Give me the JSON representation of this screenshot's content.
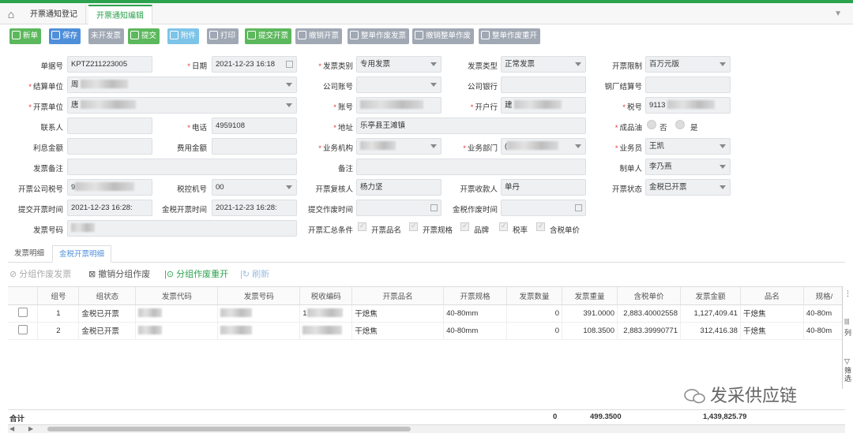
{
  "tabs": [
    "开票通知登记",
    "开票通知编辑"
  ],
  "toolbar": {
    "new": "新单",
    "save": "保存",
    "uninvoiced": "未开发票",
    "submit": "提交",
    "attach": "附件",
    "print": "打印",
    "submit_invoice": "提交开票",
    "cancel_invoice": "撤销开票",
    "void_whole": "整单作废发票",
    "cancel_void_whole": "撤销整单作废",
    "void_reissue": "整单作废重开"
  },
  "form": {
    "doc_no": {
      "label": "单据号",
      "value": "KPTZ211223005"
    },
    "date": {
      "label": "日期",
      "value": "2021-12-23 16:18"
    },
    "invoice_category": {
      "label": "发票类别",
      "value": "专用发票"
    },
    "invoice_type": {
      "label": "发票类型",
      "value": "正常发票"
    },
    "invoice_limit": {
      "label": "开票限制",
      "value": "百万元版"
    },
    "settle_unit": {
      "label": "结算单位",
      "value": "周"
    },
    "company_account": {
      "label": "公司账号",
      "value": ""
    },
    "company_bank": {
      "label": "公司银行",
      "value": ""
    },
    "mill_settle_no": {
      "label": "钢厂结算号",
      "value": ""
    },
    "invoice_unit": {
      "label": "开票单位",
      "value": "唐"
    },
    "account_no": {
      "label": "账号",
      "value": ""
    },
    "bank": {
      "label": "开户行",
      "value": "建"
    },
    "tax_no": {
      "label": "税号",
      "value": "9113"
    },
    "contact": {
      "label": "联系人",
      "value": ""
    },
    "phone": {
      "label": "电话",
      "value": "4959108"
    },
    "address": {
      "label": "地址",
      "value": "乐亭县王滩镇"
    },
    "oil": {
      "label": "成品油",
      "no": "否",
      "yes": "是"
    },
    "interest": {
      "label": "利息金额",
      "value": ""
    },
    "fee": {
      "label": "费用金额",
      "value": ""
    },
    "org": {
      "label": "业务机构",
      "value": ""
    },
    "dept": {
      "label": "业务部门",
      "value": "("
    },
    "salesman": {
      "label": "业务员",
      "value": "王凯"
    },
    "invoice_note": {
      "label": "发票备注",
      "value": ""
    },
    "note": {
      "label": "备注",
      "value": ""
    },
    "maker": {
      "label": "制单人",
      "value": "李乃燕"
    },
    "company_tax_no": {
      "label": "开票公司税号",
      "value": "9"
    },
    "tax_machine": {
      "label": "税控机号",
      "value": "00"
    },
    "reviewer": {
      "label": "开票复核人",
      "value": "杨力坚"
    },
    "payee": {
      "label": "开票收款人",
      "value": "单丹"
    },
    "status": {
      "label": "开票状态",
      "value": "金税已开票"
    },
    "submit_time": {
      "label": "提交开票时间",
      "value": "2021-12-23 16:28:"
    },
    "gold_time": {
      "label": "金税开票时间",
      "value": "2021-12-23 16:28:"
    },
    "void_submit_time": {
      "label": "提交作废时间",
      "value": ""
    },
    "gold_void_time": {
      "label": "金税作废时间",
      "value": ""
    },
    "invoice_no": {
      "label": "发票号码",
      "value": ""
    },
    "summary": {
      "label": "开票汇总条件",
      "opts": [
        "开票品名",
        "开票规格",
        "品牌",
        "税率",
        "含税单价"
      ]
    }
  },
  "subtabs": [
    "发票明细",
    "金税开票明细"
  ],
  "actions": {
    "group_void": "分组作废发票",
    "cancel_group_void": "撤销分组作废",
    "group_reissue": "分组作废重开",
    "refresh": "刷新"
  },
  "columns": [
    "组号",
    "组状态",
    "发票代码",
    "发票号码",
    "税收编码",
    "开票品名",
    "开票规格",
    "发票数量",
    "发票重量",
    "含税单价",
    "发票金额",
    "品名",
    "规格/"
  ],
  "rows": [
    {
      "group": "1",
      "status": "金税已开票",
      "code": "",
      "number": "",
      "tax_code": "1",
      "name": "干熄焦",
      "spec": "40-80mm",
      "qty": "0",
      "weight": "391.0000",
      "price": "2,883.40002558",
      "amount": "1,127,409.41",
      "pname": "干熄焦",
      "pspec": "40-80m"
    },
    {
      "group": "2",
      "status": "金税已开票",
      "code": "",
      "number": "",
      "tax_code": "",
      "name": "干熄焦",
      "spec": "40-80mm",
      "qty": "0",
      "weight": "108.3500",
      "price": "2,883.39990771",
      "amount": "312,416.38",
      "pname": "干熄焦",
      "pspec": "40-80m"
    }
  ],
  "totals": {
    "label": "合计",
    "qty": "0",
    "weight": "499.3500",
    "amount": "1,439,825.79"
  },
  "side_panel": {
    "col_label": "列",
    "filter_label": "筛选"
  },
  "watermark": "发采供应链"
}
